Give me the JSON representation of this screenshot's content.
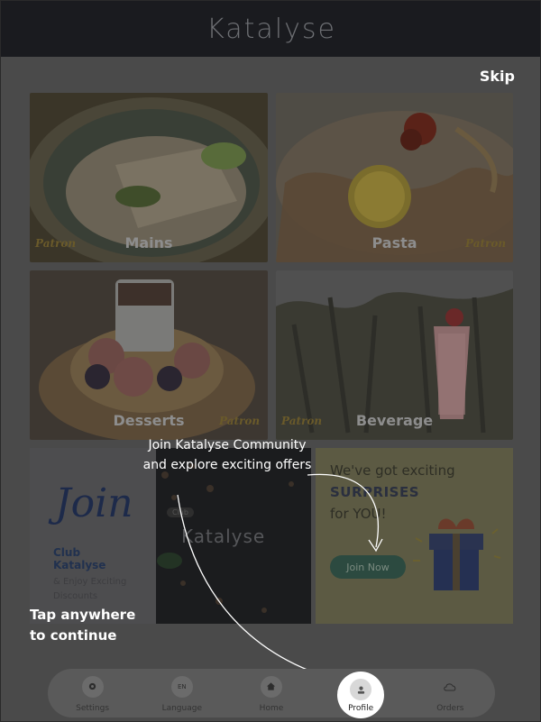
{
  "app": {
    "logo_text": "Katalyse"
  },
  "coach": {
    "skip_label": "Skip",
    "join_line1": "Join Katalyse Community",
    "join_line2": "and explore exciting offers",
    "tap_line1": "Tap anywhere",
    "tap_line2": "to continue"
  },
  "categories": [
    {
      "label": "Mains",
      "watermark": "Patron"
    },
    {
      "label": "Pasta",
      "watermark": "Patron"
    },
    {
      "label": "Desserts",
      "watermark": "Patron"
    },
    {
      "label": "Beverage",
      "watermark": "Patron"
    }
  ],
  "promos": {
    "join": {
      "title": "Join",
      "club": "Club Katalyse",
      "line1": "& Enjoy Exciting",
      "line2": "Discounts"
    },
    "dark": {
      "chip": "Club",
      "logo": "Katalyse"
    },
    "surprise": {
      "line1": "We've got exciting",
      "line2": "SURPRISES",
      "line3": "for YOU!",
      "button": "Join Now"
    }
  },
  "nav": {
    "items": [
      {
        "label": "Settings",
        "icon": "gear-icon"
      },
      {
        "label": "Language",
        "icon": "language-icon",
        "badge": "EN"
      },
      {
        "label": "Home",
        "icon": "home-icon"
      },
      {
        "label": "Profile",
        "icon": "profile-icon",
        "active": true
      },
      {
        "label": "Orders",
        "icon": "cloud-icon"
      }
    ]
  },
  "colors": {
    "header_bg": "#1a1b1f",
    "overlay_text": "#ffffff",
    "active_nav_bg": "#ffffff"
  }
}
